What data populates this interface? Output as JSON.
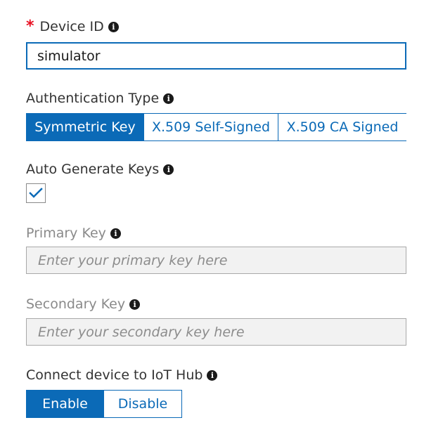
{
  "device_id": {
    "required_mark": "*",
    "label": "Device ID",
    "value": "simulator",
    "info_icon": "info-icon"
  },
  "authentication_type": {
    "label": "Authentication Type",
    "options": [
      "Symmetric Key",
      "X.509 Self-Signed",
      "X.509 CA Signed"
    ],
    "selected": "Symmetric Key",
    "info_icon": "info-icon"
  },
  "auto_generate_keys": {
    "label": "Auto Generate Keys",
    "checked": true,
    "info_icon": "info-icon"
  },
  "primary_key": {
    "label": "Primary Key",
    "placeholder": "Enter your primary key here",
    "disabled": true,
    "info_icon": "info-icon"
  },
  "secondary_key": {
    "label": "Secondary Key",
    "placeholder": "Enter your secondary key here",
    "disabled": true,
    "info_icon": "info-icon"
  },
  "connect_to_hub": {
    "label": "Connect device to IoT Hub",
    "options": [
      "Enable",
      "Disable"
    ],
    "selected": "Enable",
    "info_icon": "info-icon"
  },
  "colors": {
    "accent": "#0b6ab7",
    "required": "#e81123",
    "disabled_field_bg": "#f2f2f2"
  }
}
